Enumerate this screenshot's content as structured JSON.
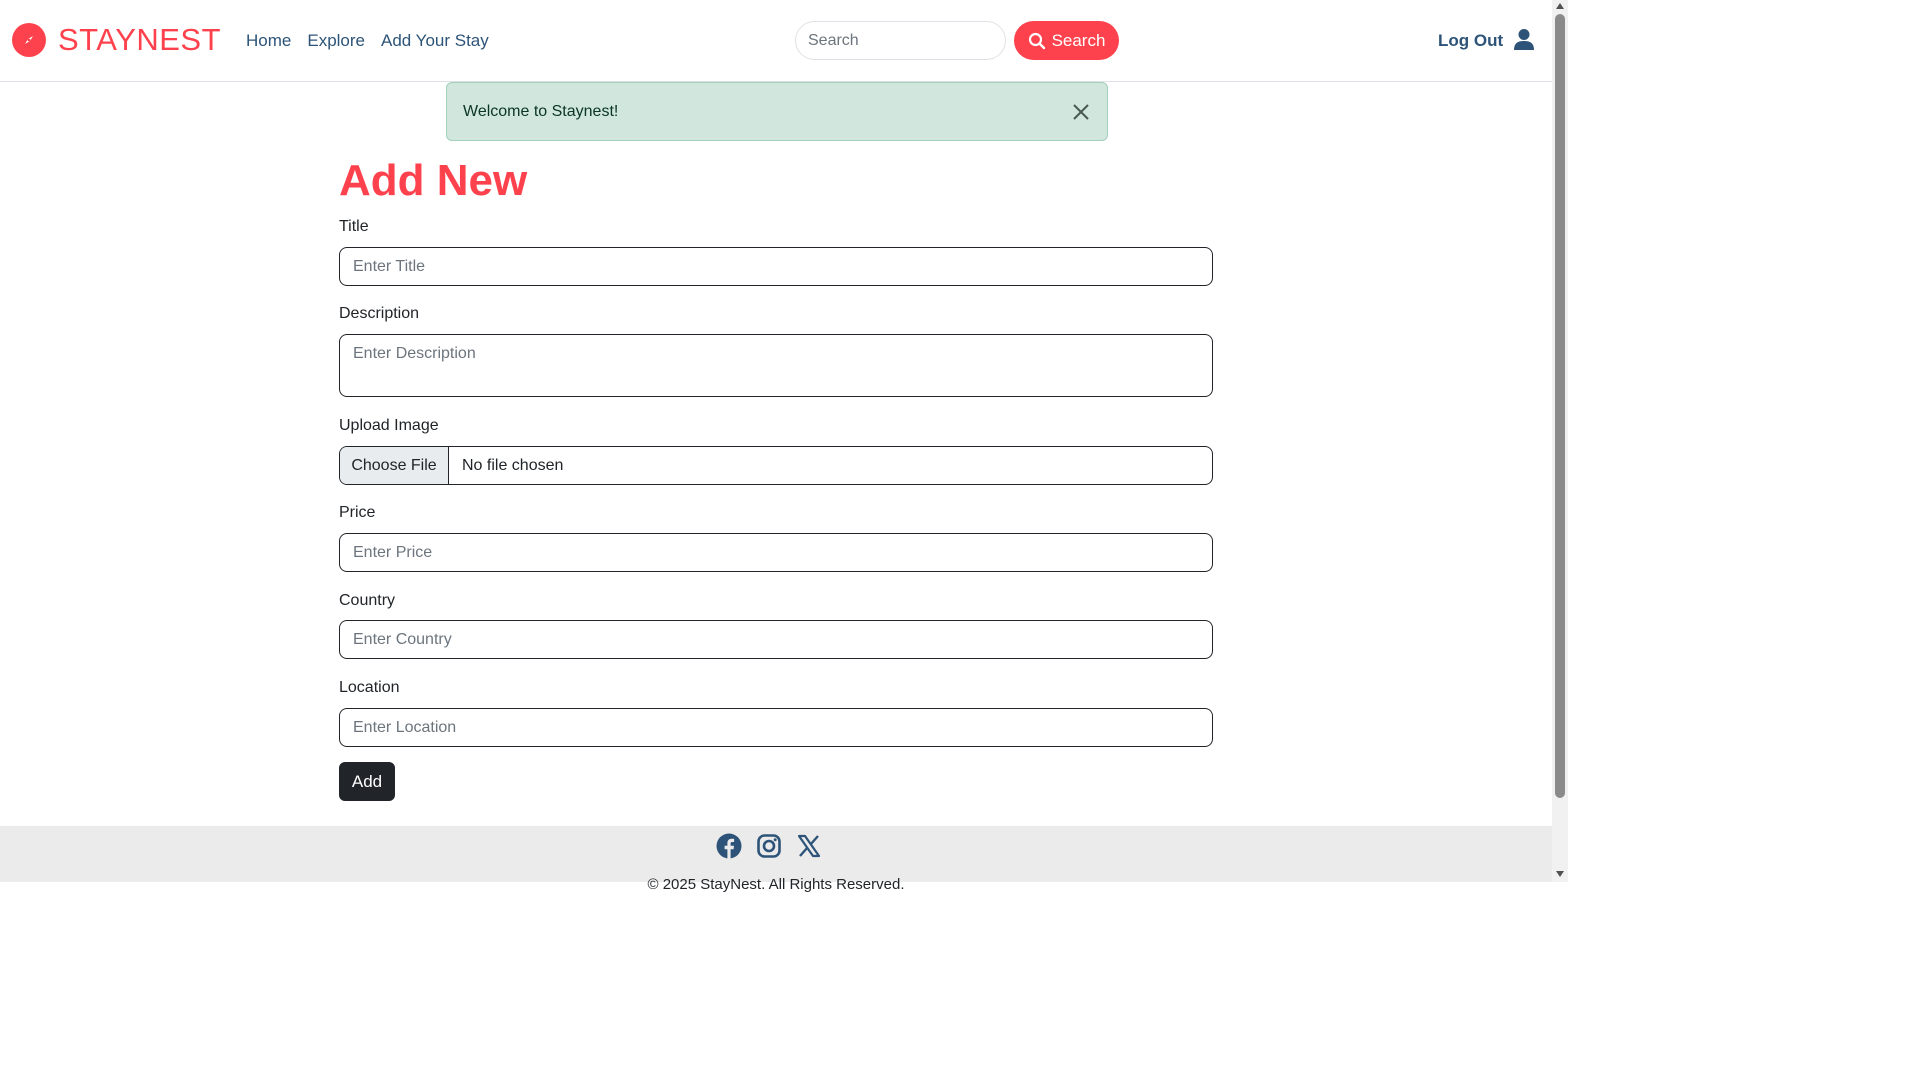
{
  "header": {
    "brand": "STAYNEST",
    "nav": [
      "Home",
      "Explore",
      "Add Your Stay"
    ],
    "search_placeholder": "Search",
    "search_button": "Search",
    "logout": "Log Out"
  },
  "alert": {
    "message": "Welcome to Staynest!"
  },
  "form": {
    "title": "Add New",
    "title_label": "Title",
    "title_placeholder": "Enter Title",
    "description_label": "Description",
    "description_placeholder": "Enter Description",
    "image_label": "Upload Image",
    "file_button": "Choose File",
    "file_status": "No file chosen",
    "price_label": "Price",
    "price_placeholder": "Enter Price",
    "country_label": "Country",
    "country_placeholder": "Enter Country",
    "location_label": "Location",
    "location_placeholder": "Enter Location",
    "submit": "Add"
  },
  "footer": {
    "socials": [
      "facebook-icon",
      "instagram-icon",
      "x-icon"
    ],
    "copyright": "© 2025 StayNest. All Rights Reserved."
  },
  "colors": {
    "brand": "#fe424d",
    "nav_link": "#2d5478",
    "alert_bg": "#d1e7dd",
    "dark_button": "#212529"
  }
}
